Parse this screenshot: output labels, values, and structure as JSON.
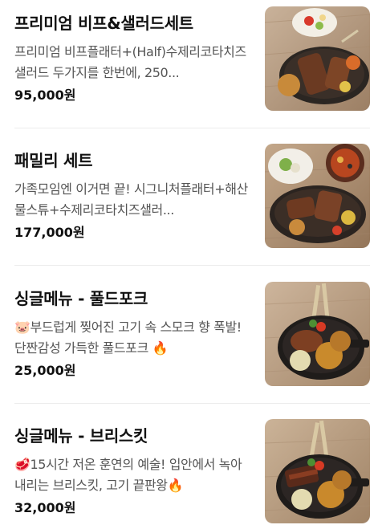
{
  "menu": {
    "items": [
      {
        "name": "프리미엄 비프&샐러드세트",
        "description": "프리미엄 비프플래터+(Half)수제리코타치즈샐러드 두가지를 한번에, 250...",
        "price": "95,000원",
        "image_icon": "beef-platter-photo"
      },
      {
        "name": "패밀리 세트",
        "description": "가족모임엔 이거면 끝! 시그니처플래터+해산물스튜+수제리코타치즈샐러...",
        "price": "177,000원",
        "image_icon": "family-platter-photo"
      },
      {
        "name": "싱글메뉴 - 풀드포크",
        "description": "🐷부드럽게 찢어진 고기 속 스모크 향 폭발! 단짠감성 가득한 풀드포크 🔥",
        "price": "25,000원",
        "image_icon": "pulled-pork-skillet-photo"
      },
      {
        "name": "싱글메뉴 - 브리스킷",
        "description": "🥩15시간 저온 훈연의 예술! 입안에서 녹아내리는 브리스킷, 고기 끝판왕🔥",
        "price": "32,000원",
        "image_icon": "brisket-skillet-photo"
      }
    ]
  },
  "colors": {
    "title": "#111111",
    "description": "#555555",
    "divider": "#ececec",
    "wood_background": "#b69a7e"
  }
}
